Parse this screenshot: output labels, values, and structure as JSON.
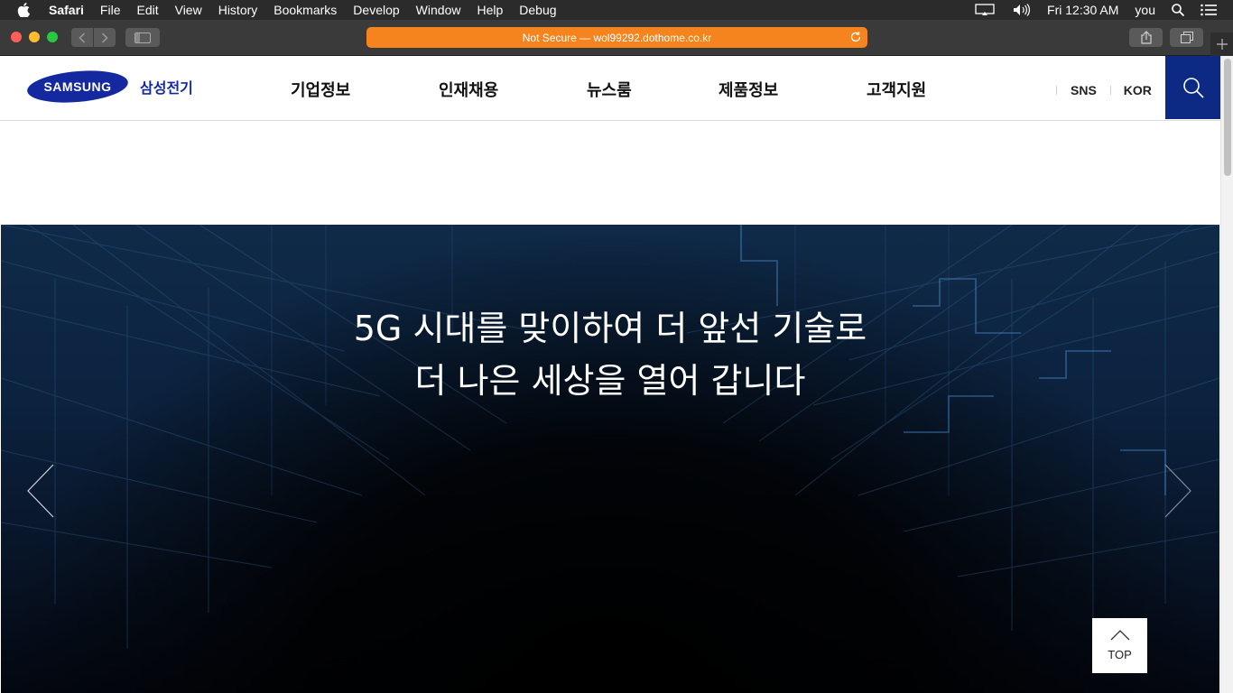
{
  "menubar": {
    "app_name": "Safari",
    "items": [
      "File",
      "Edit",
      "View",
      "History",
      "Bookmarks",
      "Develop",
      "Window",
      "Help",
      "Debug"
    ],
    "clock": "Fri 12:30 AM",
    "user": "you"
  },
  "browser": {
    "address_text": "Not Secure — wol99292.dothome.co.kr"
  },
  "site": {
    "logo_text": "SAMSUNG",
    "logo_sub": "삼성전기",
    "nav": [
      "기업정보",
      "인재채용",
      "뉴스룸",
      "제품정보",
      "고객지원"
    ],
    "util": [
      "SNS",
      "KOR"
    ],
    "brand_color": "#1428a0"
  },
  "hero": {
    "line1": "5G 시대를 맞이하여 더 앞선 기술로",
    "line2": "더 나은 세상을 열어 갑니다"
  },
  "top_button": {
    "label": "TOP"
  }
}
